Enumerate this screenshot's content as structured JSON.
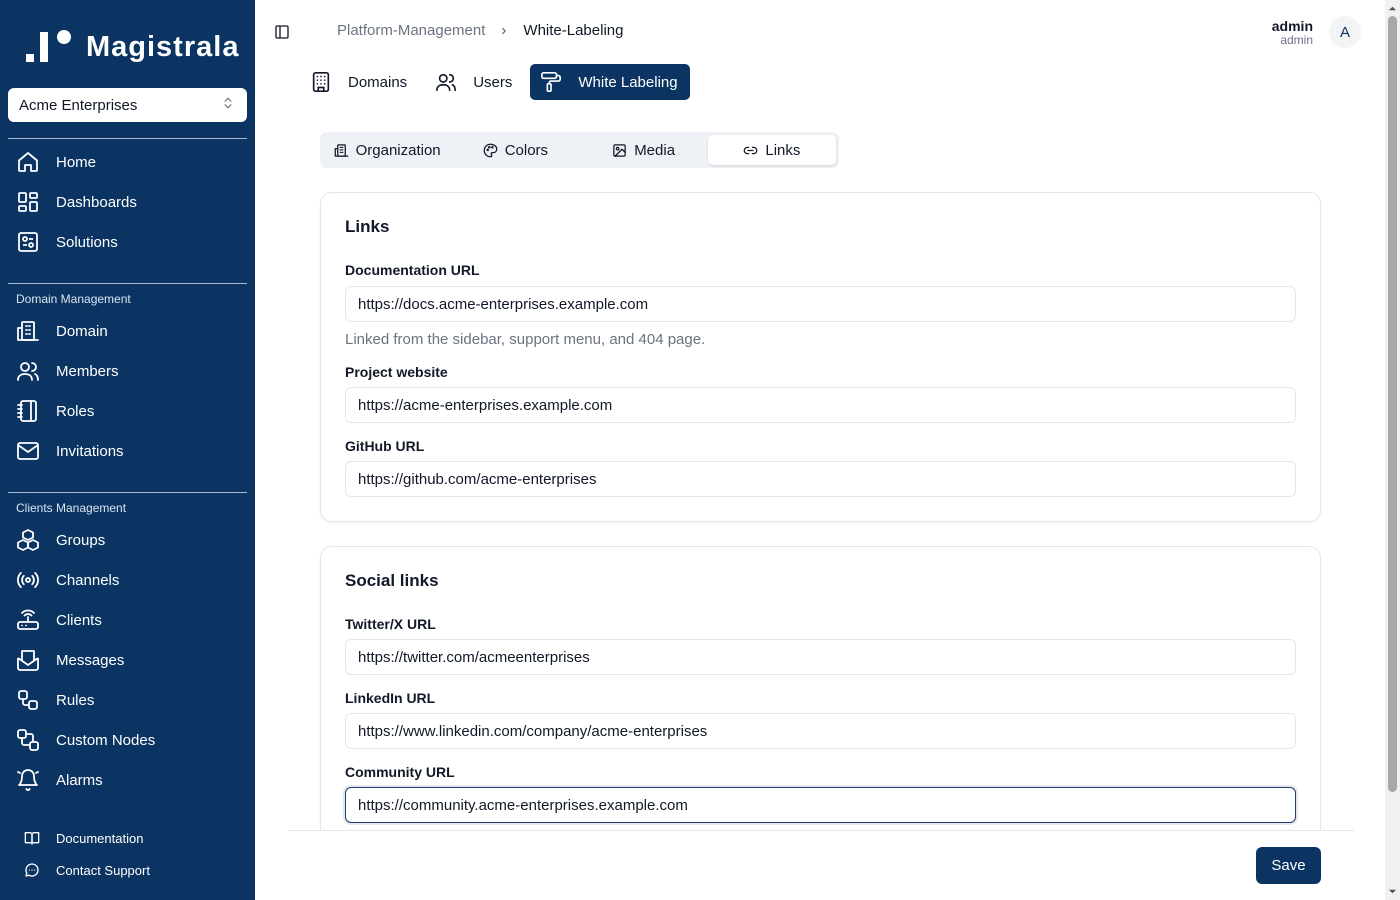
{
  "brand": {
    "name": "Magistrala"
  },
  "workspace": {
    "selected": "Acme Enterprises"
  },
  "sidebar": {
    "main_items": [
      {
        "label": "Home",
        "icon": "home-icon"
      },
      {
        "label": "Dashboards",
        "icon": "dashboards-icon"
      },
      {
        "label": "Solutions",
        "icon": "solutions-icon"
      }
    ],
    "domain_group": {
      "label": "Domain Management",
      "items": [
        {
          "label": "Domain",
          "icon": "building-icon"
        },
        {
          "label": "Members",
          "icon": "users-icon"
        },
        {
          "label": "Roles",
          "icon": "notebook-icon"
        },
        {
          "label": "Invitations",
          "icon": "mail-icon"
        }
      ]
    },
    "clients_group": {
      "label": "Clients Management",
      "items": [
        {
          "label": "Groups",
          "icon": "boxes-icon"
        },
        {
          "label": "Channels",
          "icon": "radio-icon"
        },
        {
          "label": "Clients",
          "icon": "router-icon"
        },
        {
          "label": "Messages",
          "icon": "mail-open-icon"
        },
        {
          "label": "Rules",
          "icon": "workflow-icon"
        },
        {
          "label": "Custom Nodes",
          "icon": "nodes-icon"
        },
        {
          "label": "Alarms",
          "icon": "bell-icon"
        }
      ]
    },
    "footer": [
      {
        "label": "Documentation",
        "icon": "book-icon"
      },
      {
        "label": "Contact Support",
        "icon": "chat-icon"
      }
    ]
  },
  "header": {
    "breadcrumb": [
      "Platform-Management",
      "White-Labeling"
    ],
    "user": {
      "name": "admin",
      "role": "admin",
      "avatar_initial": "A"
    }
  },
  "top_tabs": [
    {
      "label": "Domains",
      "icon": "building-icon",
      "active": false
    },
    {
      "label": "Users",
      "icon": "users-icon",
      "active": false
    },
    {
      "label": "White Labeling",
      "icon": "paint-roller-icon",
      "active": true
    }
  ],
  "sub_tabs": [
    {
      "label": "Organization",
      "icon": "building-icon",
      "active": false
    },
    {
      "label": "Colors",
      "icon": "palette-icon",
      "active": false
    },
    {
      "label": "Media",
      "icon": "image-icon",
      "active": false
    },
    {
      "label": "Links",
      "icon": "link-icon",
      "active": true
    }
  ],
  "links_card": {
    "title": "Links",
    "fields": [
      {
        "label": "Documentation URL",
        "value": "https://docs.acme-enterprises.example.com",
        "help": "Linked from the sidebar, support menu, and 404 page."
      },
      {
        "label": "Project website",
        "value": "https://acme-enterprises.example.com"
      },
      {
        "label": "GitHub URL",
        "value": "https://github.com/acme-enterprises"
      }
    ]
  },
  "social_card": {
    "title": "Social links",
    "fields": [
      {
        "label": "Twitter/X URL",
        "value": "https://twitter.com/acmeenterprises"
      },
      {
        "label": "LinkedIn URL",
        "value": "https://www.linkedin.com/company/acme-enterprises"
      },
      {
        "label": "Community URL",
        "value": "https://community.acme-enterprises.example.com"
      }
    ]
  },
  "actions": {
    "save_label": "Save"
  },
  "colors": {
    "sidebar": "#0b3463",
    "accent": "#0b3463",
    "muted_text": "#6b7280",
    "border": "#e5e7eb"
  }
}
